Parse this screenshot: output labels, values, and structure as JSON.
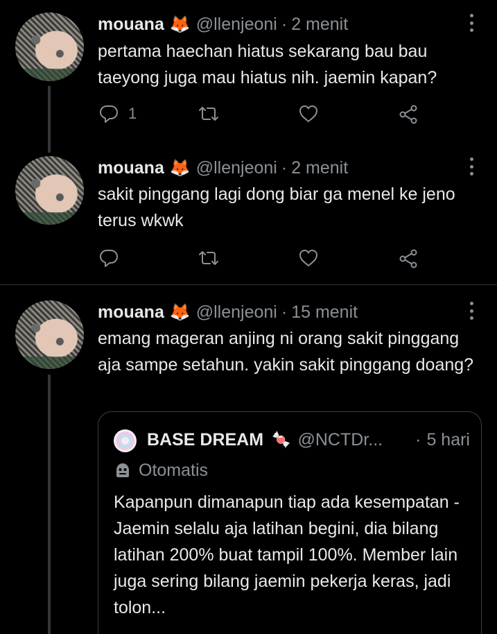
{
  "tweets": [
    {
      "author_name": "mouana",
      "author_emoji": "🦊",
      "handle": "@llenjeoni",
      "separator": "·",
      "time": "2 menit",
      "text": "pertama haechan hiatus sekarang bau bau taeyong juga mau hiatus nih. jaemin kapan?",
      "reply_count": "1"
    },
    {
      "author_name": "mouana",
      "author_emoji": "🦊",
      "handle": "@llenjeoni",
      "separator": "·",
      "time": "2 menit",
      "text": "sakit pinggang lagi dong biar ga menel ke jeno terus wkwk",
      "reply_count": ""
    },
    {
      "author_name": "mouana",
      "author_emoji": "🦊",
      "handle": "@llenjeoni",
      "separator": "·",
      "time": "15 menit",
      "text": "emang mageran anjing ni orang sakit pinggang aja sampe setahun. yakin sakit pinggang doang?"
    }
  ],
  "quote": {
    "name": "BASE DREAM",
    "name_emoji": "🍬",
    "handle": "@NCTDr...",
    "separator": "·",
    "time": "5 hari",
    "label": "Otomatis",
    "text": "Kapanpun dimanapun tiap ada kesempatan -Jaemin selalu aja latihan begini, dia bilang latihan 200% buat tampil 100%. Member lain juga sering bilang jaemin pekerja keras, jadi tolon..."
  },
  "icons": {
    "reply": "reply-icon",
    "retweet": "retweet-icon",
    "like": "like-icon",
    "share": "share-icon",
    "more": "more-icon",
    "bot": "bot-icon"
  },
  "colors": {
    "background": "#000000",
    "text": "#e7e9ea",
    "secondary": "#8b9196",
    "divider": "#2f3336"
  }
}
